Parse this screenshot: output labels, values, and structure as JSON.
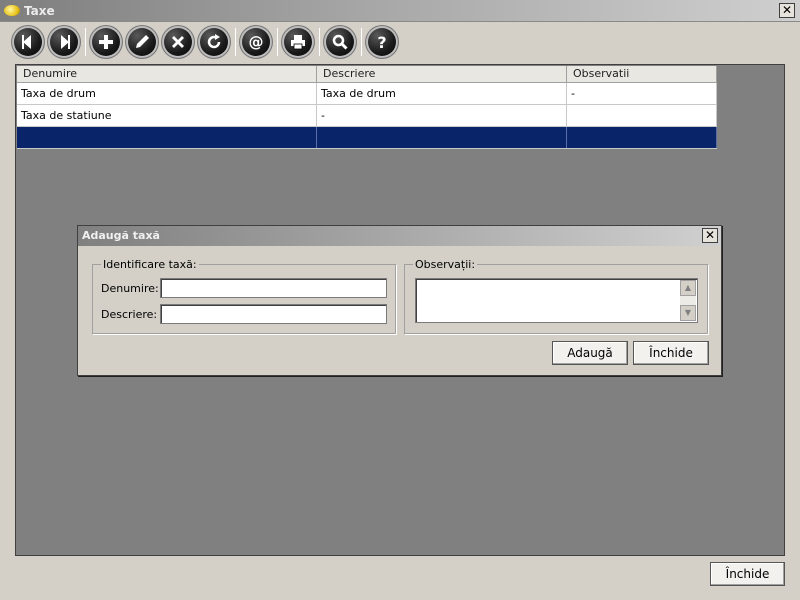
{
  "window": {
    "title": "Taxe",
    "close_glyph": "✕"
  },
  "toolbar": {
    "buttons": [
      {
        "icon": "first-record-icon"
      },
      {
        "icon": "last-record-icon"
      },
      {
        "icon": "add-icon"
      },
      {
        "icon": "edit-icon"
      },
      {
        "icon": "delete-icon"
      },
      {
        "icon": "refresh-icon"
      },
      {
        "icon": "email-icon"
      },
      {
        "icon": "print-icon"
      },
      {
        "icon": "search-icon"
      },
      {
        "icon": "help-icon"
      }
    ]
  },
  "grid": {
    "columns": [
      "Denumire",
      "Descriere",
      "Observatii"
    ],
    "rows": [
      [
        "Taxa de drum",
        "Taxa de drum",
        "-"
      ],
      [
        "Taxa de statiune",
        "-",
        ""
      ],
      [
        "",
        "",
        ""
      ]
    ],
    "selected_row": 2,
    "selected_color": "#0a246a"
  },
  "dialog": {
    "title": "Adaugă taxă",
    "close_glyph": "✕",
    "group_identificare": "Identificare taxă:",
    "label_denumire": "Denumire:",
    "value_denumire": "",
    "label_descriere": "Descriere:",
    "value_descriere": "",
    "group_observatii": "Observații:",
    "value_observatii": "",
    "btn_add": "Adaugă",
    "btn_close": "Închide"
  },
  "footer": {
    "close_label": "Închide"
  }
}
